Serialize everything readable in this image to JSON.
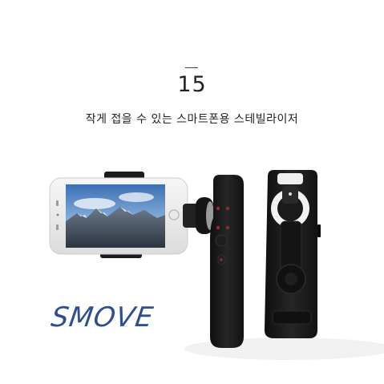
{
  "rank": {
    "number": "15"
  },
  "title": {
    "text": "작게 접을 수 있는 스마트폰용 스테빌라이저"
  },
  "brand": {
    "logo_text": "SMOVE"
  },
  "colors": {
    "logo": "#2f4f8a",
    "device_body": "#1a1a1a",
    "button_red": "#7a2a2a",
    "phone_frame": "#eeeeee"
  },
  "icons": [
    "gimbal-handle-front",
    "gimbal-handle-back",
    "smartphone-mountain-screen"
  ]
}
